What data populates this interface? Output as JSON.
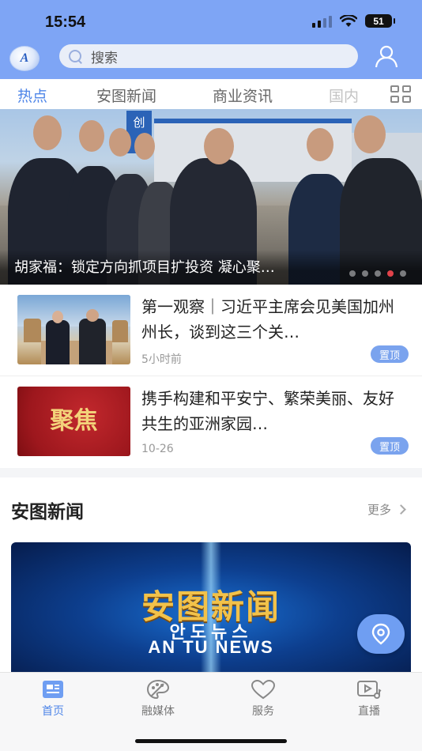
{
  "status_bar": {
    "time": "15:54",
    "battery": "51"
  },
  "header": {
    "logo_text": "A",
    "search_placeholder": "搜索",
    "icons": [
      "search-icon",
      "user-icon"
    ],
    "accent_color": "#7ea5f5"
  },
  "tabs": [
    {
      "label": "热点",
      "active": true
    },
    {
      "label": "安图新闻",
      "active": false
    },
    {
      "label": "商业资讯",
      "active": false
    },
    {
      "label": "国内",
      "active": false
    }
  ],
  "banner": {
    "title": "胡家福：锁定方向抓项目扩投资 凝心聚…",
    "sign_text": "创",
    "dots_count": 5,
    "active_dot": 4
  },
  "news": [
    {
      "title": "第一观察｜习近平主席会见美国加州州长，谈到这三个关…",
      "time": "5小时前",
      "badge": "置顶"
    },
    {
      "title": "携手构建和平安宁、繁荣美丽、友好共生的亚洲家园…",
      "time": "10-26",
      "badge": "置顶",
      "thumb_text": "聚焦"
    }
  ],
  "section": {
    "title": "安图新闻",
    "more_label": "更多",
    "video_title_cn": "安图新闻",
    "video_title_kr": "안도뉴스",
    "video_title_en": "AN TU NEWS"
  },
  "tabbar": [
    {
      "label": "首页",
      "icon": "news-icon",
      "active": true
    },
    {
      "label": "融媒体",
      "icon": "palette-icon",
      "active": false
    },
    {
      "label": "服务",
      "icon": "heart-icon",
      "active": false
    },
    {
      "label": "直播",
      "icon": "video-icon",
      "active": false
    }
  ],
  "colors": {
    "accent": "#4f86e8",
    "badge": "#7aa3ee",
    "active_dot": "#e0424a"
  }
}
